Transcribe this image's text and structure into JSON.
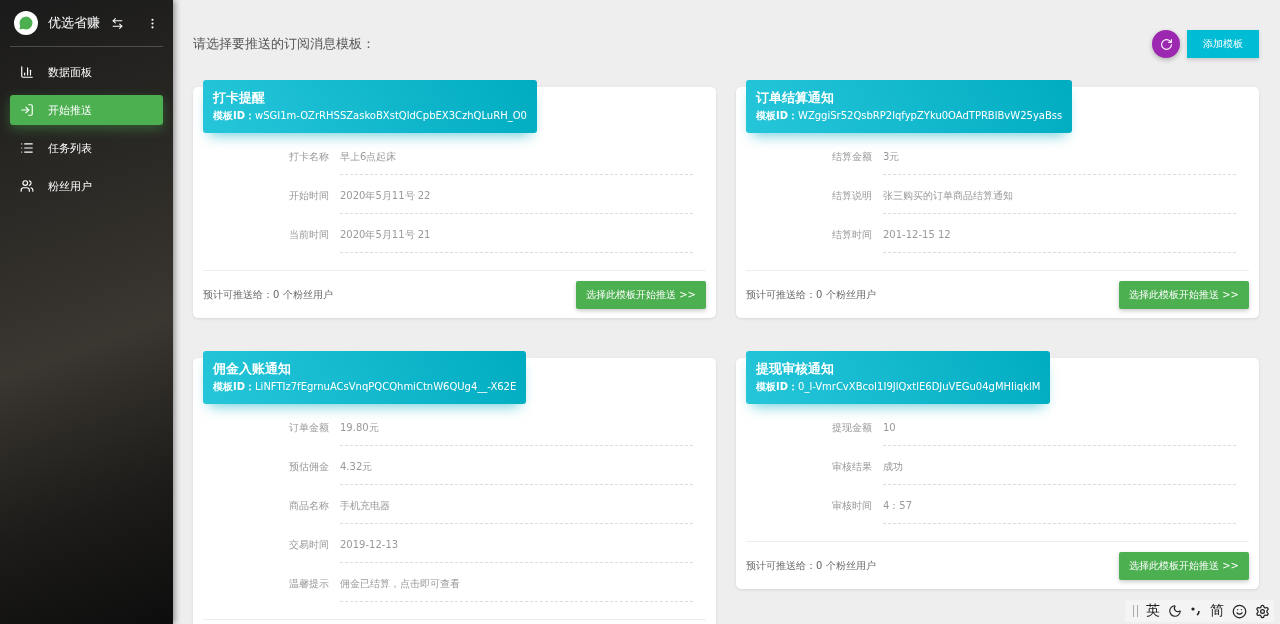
{
  "sidebar": {
    "brand": "优选省赚",
    "items": [
      {
        "label": "数据面板",
        "selected": false
      },
      {
        "label": "开始推送",
        "selected": true
      },
      {
        "label": "任务列表",
        "selected": false
      },
      {
        "label": "粉丝用户",
        "selected": false
      }
    ]
  },
  "heading": "请选择要推送的订阅消息模板：",
  "add_button": "添加模板",
  "templates": [
    {
      "title": "打卡提醒",
      "id_label": "模板ID：",
      "id": "wSGI1m-OZrRHSSZaskoBXstQldCpbEX3CzhQLuRH_O0",
      "fields": [
        {
          "label": "打卡名称",
          "value": "早上6点起床"
        },
        {
          "label": "开始时间",
          "value": "2020年5月11号 22"
        },
        {
          "label": "当前时间",
          "value": "2020年5月11号 21"
        }
      ],
      "footer": {
        "text": "预计可推送给：0 个粉丝用户",
        "button": "选择此模板开始推送 >>"
      }
    },
    {
      "title": "订单结算通知",
      "id_label": "模板ID：",
      "id": "WZggiSr52QsbRP2lqfypZYku0OAdTPRBlBvW25yaBss",
      "fields": [
        {
          "label": "结算金额",
          "value": "3元"
        },
        {
          "label": "结算说明",
          "value": "张三购买的订单商品结算通知"
        },
        {
          "label": "结算时间",
          "value": "201-12-15 12"
        }
      ],
      "footer": {
        "text": "预计可推送给：0 个粉丝用户",
        "button": "选择此模板开始推送 >>"
      }
    },
    {
      "title": "佣金入账通知",
      "id_label": "模板ID：",
      "id": "LiNFTIz7fEgrnuACsVnqPQCQhmiCtnW6QUg4__-X62E",
      "fields": [
        {
          "label": "订单金额",
          "value": "19.80元"
        },
        {
          "label": "预估佣金",
          "value": "4.32元"
        },
        {
          "label": "商品名称",
          "value": "手机充电器"
        },
        {
          "label": "交易时间",
          "value": "2019-12-13"
        },
        {
          "label": "温馨提示",
          "value": "佣金已结算，点击即可查看"
        }
      ]
    },
    {
      "title": "提现审核通知",
      "id_label": "模板ID：",
      "id": "0_l-VmrCvXBcoI1I9JlQxtlE6DJuVEGu04gMHIiqklM",
      "fields": [
        {
          "label": "提现金额",
          "value": "10"
        },
        {
          "label": "审核结果",
          "value": "成功"
        },
        {
          "label": "审核时间",
          "value": "4：57"
        }
      ],
      "footer": {
        "text": "预计可推送给：0 个粉丝用户",
        "button": "选择此模板开始推送 >>"
      }
    }
  ],
  "ime_bar": {
    "mode": "英",
    "script": "简"
  }
}
